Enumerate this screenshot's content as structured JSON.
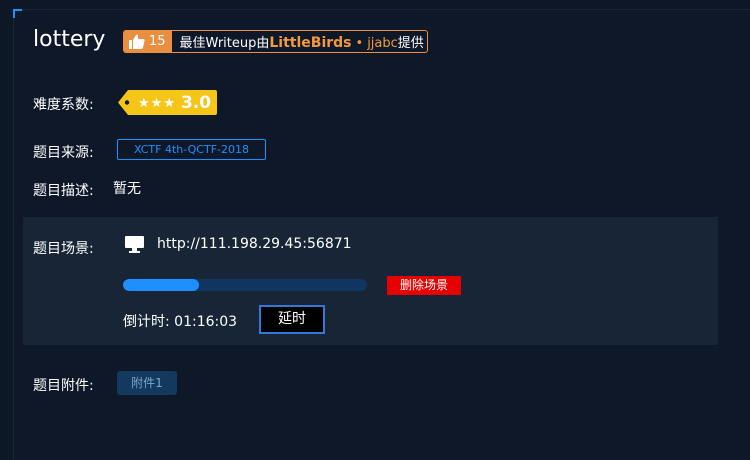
{
  "challenge": {
    "title": "lottery",
    "writeup": {
      "likes": "15",
      "prefix": "最佳Writeup由",
      "author": "LittleBirds",
      "separator": "•",
      "contributor": "jjabc",
      "suffix": "提供"
    }
  },
  "difficulty": {
    "label": "难度系数:",
    "stars": [
      "★",
      "★",
      "★"
    ],
    "value": "3.0"
  },
  "source": {
    "label": "题目来源:",
    "tag": "XCTF 4th-QCTF-2018"
  },
  "description": {
    "label": "题目描述:",
    "value": "暂无"
  },
  "scene": {
    "label": "题目场景:",
    "url": "http://111.198.29.45:56871",
    "progress_percent": 31,
    "delete_label": "删除场景",
    "countdown_label": "倒计时:",
    "countdown_value": "01:16:03",
    "extend_label": "延时"
  },
  "attachment": {
    "label": "题目附件:",
    "button": "附件1"
  },
  "colors": {
    "accent": "#1e8fff",
    "writeup_orange": "#e98f3f",
    "star_gold": "#f5c518",
    "delete_red": "#e60000"
  },
  "icons": {
    "like": "thumbs-up-icon",
    "scene": "monitor-icon"
  }
}
